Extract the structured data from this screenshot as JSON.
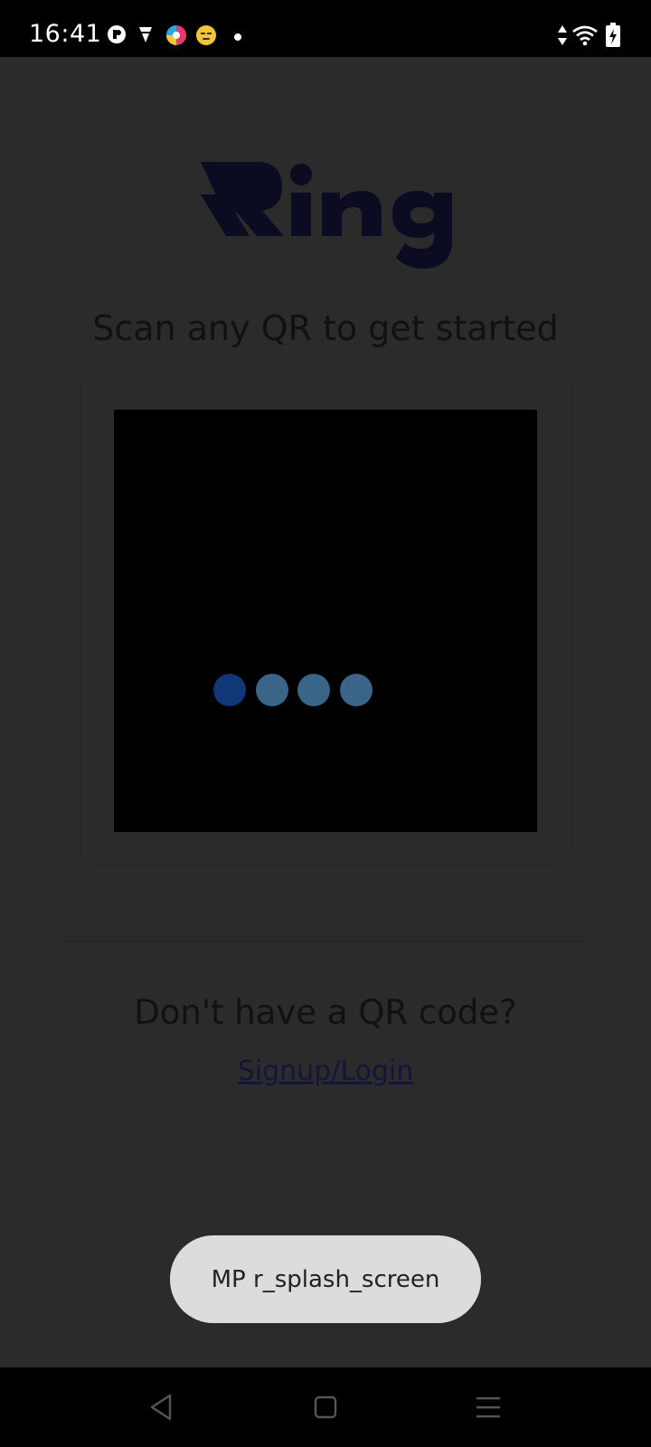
{
  "status_bar": {
    "time": "16:41",
    "notification_icons": [
      "reader-app-icon",
      "vpn-icon",
      "colorful-app-icon",
      "emoji-app-icon",
      "more-dot-icon"
    ],
    "right_icons": [
      "data-arrows-icon",
      "wifi-icon",
      "battery-charging-icon"
    ]
  },
  "app": {
    "logo_text": "Ring",
    "headline": "Scan any QR to get started",
    "loader_colors": [
      "#103878",
      "#3a6488",
      "#3a6488",
      "#3a6488"
    ],
    "no_qr_prompt": "Don't have a QR code?",
    "signup_link": "Signup/Login"
  },
  "toast": {
    "message": "MP r_splash_screen"
  },
  "nav_bar": {
    "buttons": [
      "back-icon",
      "home-icon",
      "recents-icon"
    ]
  },
  "colors": {
    "overlay_bg": "#2b2b2b",
    "logo": "#0b0b22",
    "link": "#13153a",
    "toast_bg": "#dcdcdc"
  }
}
